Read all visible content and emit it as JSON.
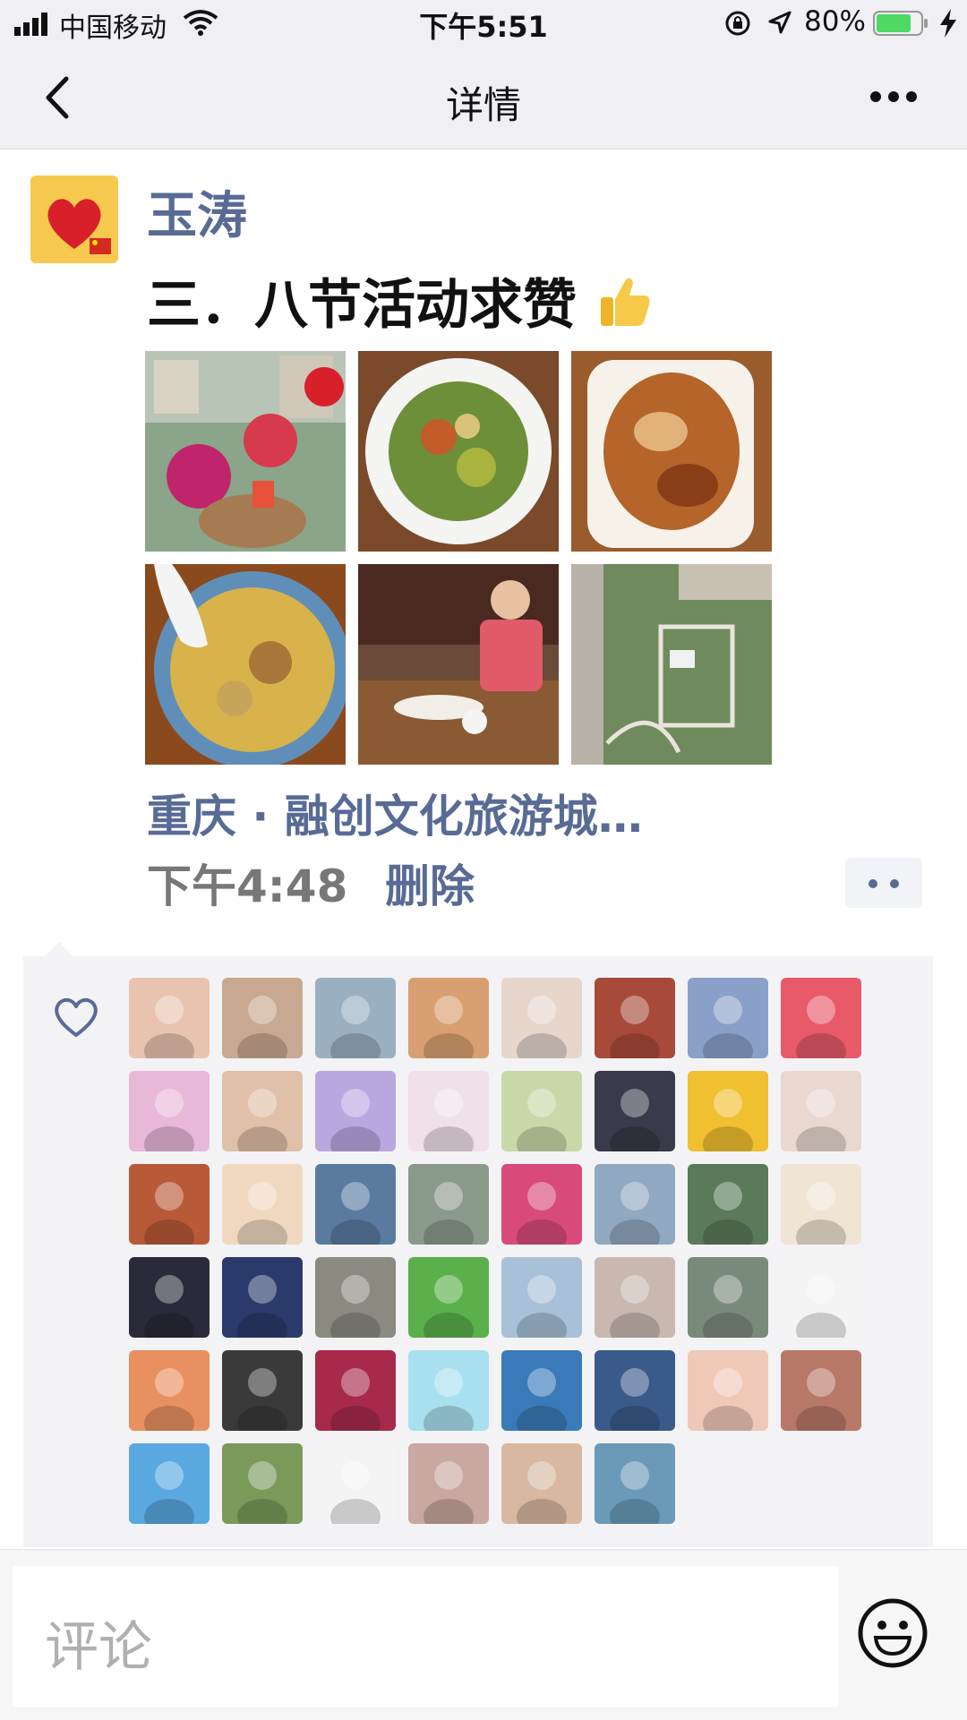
{
  "status_bar": {
    "carrier": "中国移动",
    "time": "下午5:51",
    "battery_percent": "80%",
    "battery_level": 0.8
  },
  "nav": {
    "title": "详情"
  },
  "post": {
    "author": "玉涛",
    "text": "三．八节活动求赞",
    "location": "重庆 · 融创文化旅游城…",
    "time": "下午4:48",
    "delete_label": "删除",
    "photos": [
      {
        "icon": "balcony-flowers-photo"
      },
      {
        "icon": "noodle-salad-photo"
      },
      {
        "icon": "fried-pork-photo"
      },
      {
        "icon": "soup-bowl-photo"
      },
      {
        "icon": "woman-dining-photo"
      },
      {
        "icon": "garden-aerial-photo"
      }
    ]
  },
  "likes": {
    "count_shown": 46
  },
  "comment": {
    "placeholder": "评论"
  },
  "colors": {
    "link_blue": "#586b95",
    "nav_bg": "#efeff4",
    "likes_bg": "#f3f3f5",
    "battery_green": "#4cd964"
  }
}
